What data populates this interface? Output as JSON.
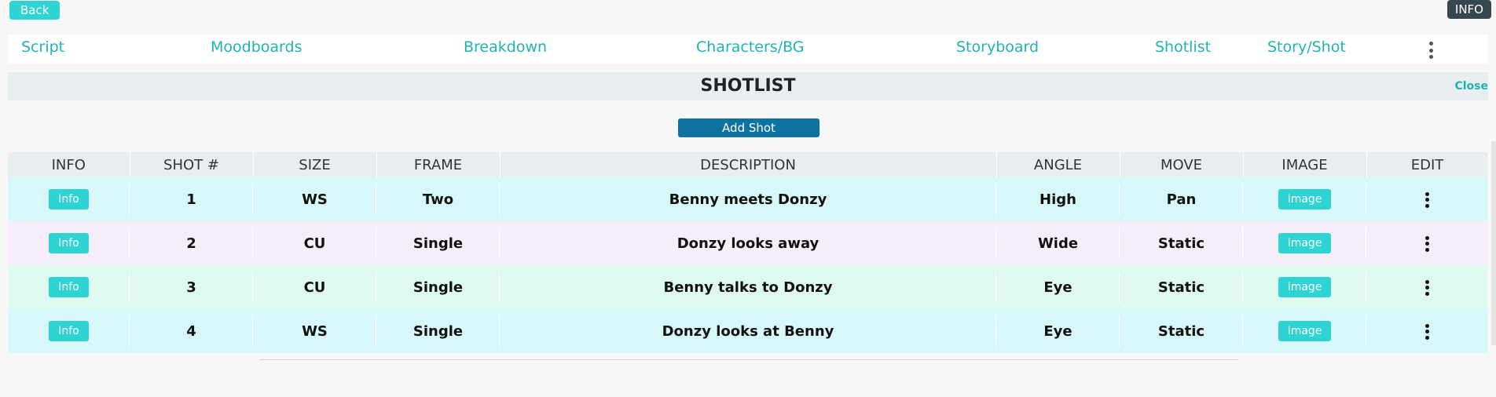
{
  "top": {
    "back_label": "Back",
    "info_label": "INFO"
  },
  "nav": {
    "items": [
      {
        "label": "Script"
      },
      {
        "label": "Moodboards"
      },
      {
        "label": "Breakdown"
      },
      {
        "label": "Characters/BG"
      },
      {
        "label": "Storyboard"
      },
      {
        "label": "Shotlist"
      },
      {
        "label": "Story/Shot"
      }
    ],
    "more_icon": "vertical-ellipsis-icon"
  },
  "shotlist": {
    "title": "SHOTLIST",
    "close_label": "Close",
    "add_shot_label": "Add Shot",
    "columns": [
      "INFO",
      "SHOT #",
      "SIZE",
      "FRAME",
      "DESCRIPTION",
      "ANGLE",
      "MOVE",
      "IMAGE",
      "EDIT"
    ],
    "rows": [
      {
        "info": "Info",
        "shot": "1",
        "size": "WS",
        "frame": "Two",
        "description": "Benny meets Donzy",
        "angle": "High",
        "move": "Pan",
        "image": "Image"
      },
      {
        "info": "Info",
        "shot": "2",
        "size": "CU",
        "frame": "Single",
        "description": "Donzy looks away",
        "angle": "Wide",
        "move": "Static",
        "image": "Image"
      },
      {
        "info": "Info",
        "shot": "3",
        "size": "CU",
        "frame": "Single",
        "description": "Benny talks to Donzy",
        "angle": "Eye",
        "move": "Static",
        "image": "Image"
      },
      {
        "info": "Info",
        "shot": "4",
        "size": "WS",
        "frame": "Single",
        "description": "Donzy looks at Benny",
        "angle": "Eye",
        "move": "Static",
        "image": "Image"
      }
    ]
  },
  "colors": {
    "accent": "#2ed3d3",
    "nav_text": "#1fb3b5",
    "add_shot_bg": "#0d73a0",
    "info_badge_bg": "#37474f"
  }
}
